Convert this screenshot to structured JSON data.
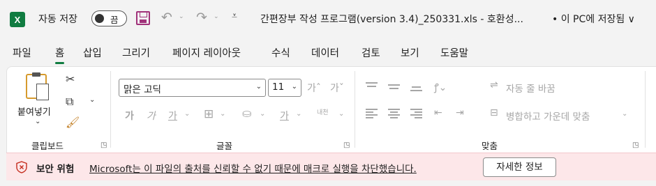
{
  "titlebar": {
    "app_letter": "X",
    "autosave_label": "자동 저장",
    "autosave_state": "끔",
    "file_title": "간편장부 작성 프로그램(version 3.4)_250331.xls  -  호환성...",
    "save_location": "• 이 PC에 저장됨 ∨"
  },
  "tabs": [
    {
      "label": "파일"
    },
    {
      "label": "홈"
    },
    {
      "label": "삽입"
    },
    {
      "label": "그리기"
    },
    {
      "label": "페이지 레이아웃"
    },
    {
      "label": "수식"
    },
    {
      "label": "데이터"
    },
    {
      "label": "검토"
    },
    {
      "label": "보기"
    },
    {
      "label": "도움말"
    }
  ],
  "active_tab": "홈",
  "clipboard": {
    "paste_label": "붙여넣기",
    "group_label": "클립보드"
  },
  "font": {
    "font_name": "맑은 고딕",
    "font_size": "11",
    "group_label": "글꼴",
    "bold": "가",
    "italic": "가",
    "underline": "가",
    "font_color": "가",
    "phonetic": "내천"
  },
  "alignment": {
    "wrap_text": "자동 줄 바꿈",
    "merge_center": "병합하고 가운데 맞춤",
    "group_label": "맞춤"
  },
  "security": {
    "title": "보안 위험",
    "message": "Microsoft는 이 파일의 출처를 신뢰할 수 없기 때문에 매크로 실행을 차단했습니다.",
    "details_button": "자세한 정보"
  },
  "colors": {
    "excel_green": "#107c41",
    "save_purple": "#a1327a",
    "security_bg": "#fde7e9",
    "security_icon": "#c42b1c"
  }
}
